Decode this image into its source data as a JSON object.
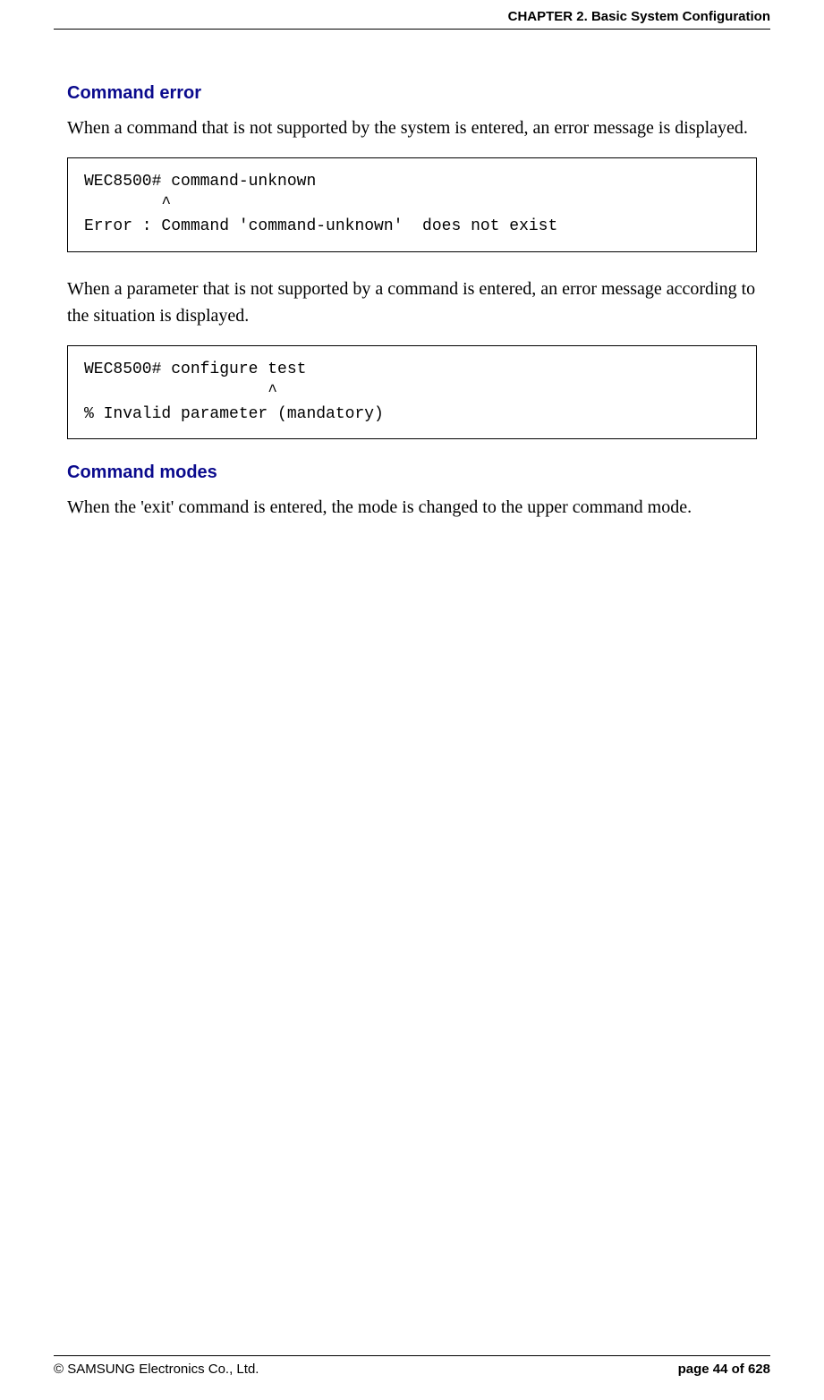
{
  "header": {
    "chapter": "CHAPTER 2. Basic System Configuration"
  },
  "sections": {
    "command_error": {
      "heading": "Command error",
      "para1": "When a command that is not supported by the system is entered, an error message is displayed.",
      "code1": "WEC8500# command-unknown\n        ^\nError : Command 'command-unknown'  does not exist",
      "para2": "When a parameter that is not supported by a command is entered, an error message according to the situation is displayed.",
      "code2": "WEC8500# configure test\n                   ^\n% Invalid parameter (mandatory)"
    },
    "command_modes": {
      "heading": "Command modes",
      "para1": "When the 'exit' command is entered, the mode is changed to the upper command mode."
    }
  },
  "footer": {
    "copyright": "© SAMSUNG Electronics Co., Ltd.",
    "page": "page 44 of 628"
  }
}
